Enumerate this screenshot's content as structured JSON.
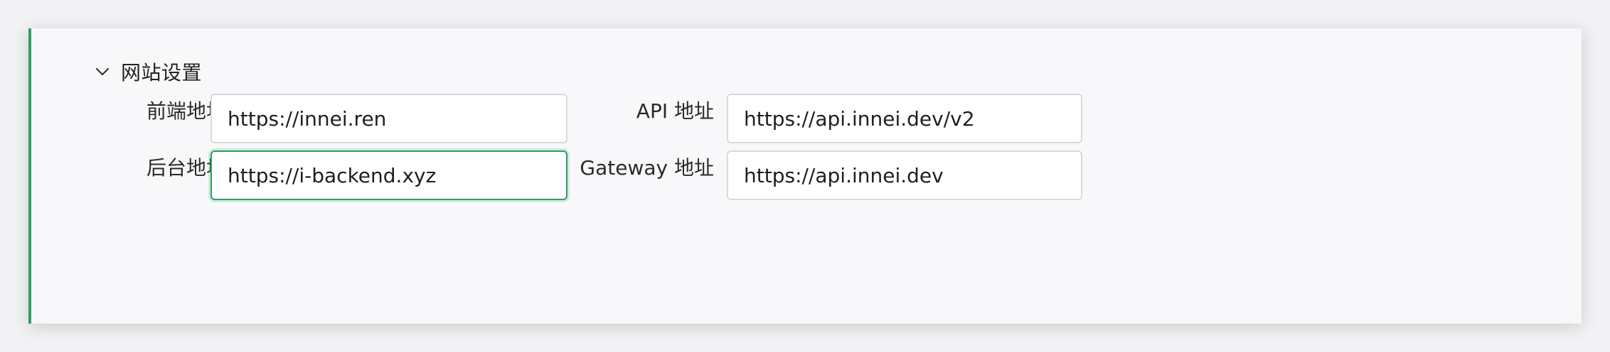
{
  "section": {
    "title": "网站设置",
    "icon": "chevron-down-icon"
  },
  "fields": {
    "frontend": {
      "label": "前端地址",
      "value": "https://innei.ren"
    },
    "backend": {
      "label": "后台地址",
      "value": "https://i-backend.xyz"
    },
    "api": {
      "label": "API 地址",
      "value": "https://api.innei.dev/v2"
    },
    "gateway": {
      "label": "Gateway 地址",
      "value": "https://api.innei.dev"
    }
  },
  "colors": {
    "accent": "#2e9e62",
    "card_bg": "#f8f8fa",
    "input_border": "#d9d9dd"
  }
}
